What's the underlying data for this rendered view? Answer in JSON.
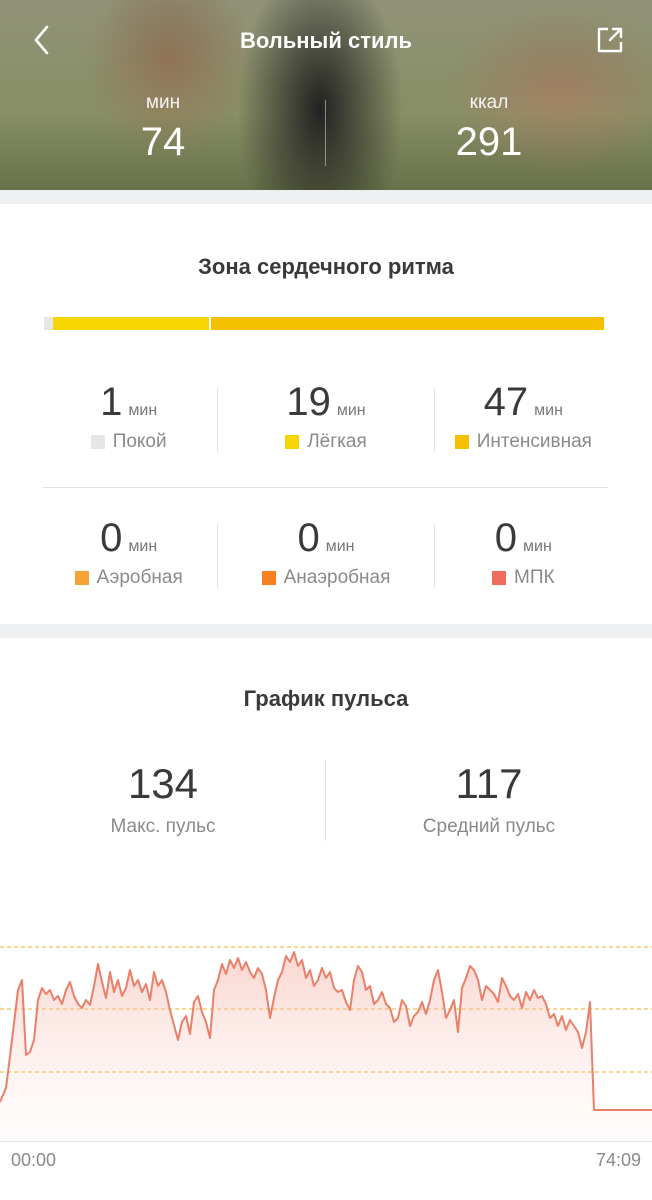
{
  "header": {
    "title": "Вольный стиль",
    "stats": [
      {
        "label": "мин",
        "value": "74"
      },
      {
        "label": "ккал",
        "value": "291"
      }
    ]
  },
  "heart_zones": {
    "title": "Зона сердечного ритма",
    "unit": "мин",
    "zones": [
      {
        "value": "1",
        "name": "Покой",
        "color": "#e6e6e6"
      },
      {
        "value": "19",
        "name": "Лёгкая",
        "color": "#f7d500"
      },
      {
        "value": "47",
        "name": "Интенсивная",
        "color": "#f5c000"
      },
      {
        "value": "0",
        "name": "Аэробная",
        "color": "#f7a234"
      },
      {
        "value": "0",
        "name": "Анаэробная",
        "color": "#f5821f"
      },
      {
        "value": "0",
        "name": "МПК",
        "color": "#ef6b5a"
      }
    ]
  },
  "pulse": {
    "title": "График пульса",
    "max": {
      "value": "134",
      "label": "Макс. пульс"
    },
    "avg": {
      "value": "117",
      "label": "Средний пульс"
    },
    "time_start": "00:00",
    "time_end": "74:09"
  },
  "colors": {
    "line": "#e8806a",
    "dashed": "#f0c24a"
  }
}
